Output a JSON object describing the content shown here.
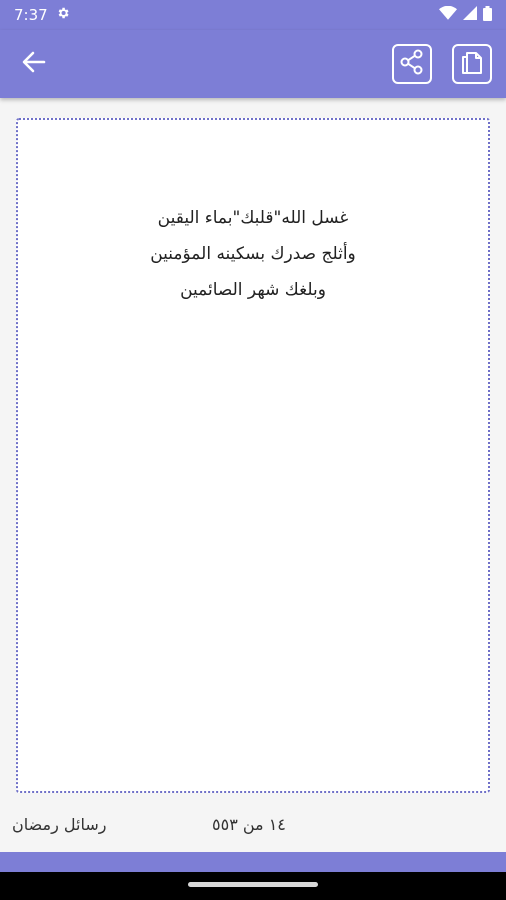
{
  "status_bar": {
    "time": "7:37",
    "icons": [
      "gear-icon",
      "wifi-icon",
      "signal-icon",
      "battery-icon"
    ]
  },
  "app_bar": {
    "back_icon": "arrow-left-icon",
    "share_icon": "share-icon",
    "copy_icon": "copy-icon"
  },
  "message": {
    "lines": [
      "غسل الله\"قلبك\"بماء اليقين",
      "وأثلج صدرك بسكينه المؤمنين",
      "وبلغك شهر الصائمين"
    ]
  },
  "footer": {
    "category": "رسائل رمضان",
    "counter": "١٤ من ٥٥٣"
  },
  "colors": {
    "primary": "#7d7ed6",
    "card_border": "#6f70c8",
    "background": "#f5f5f5"
  }
}
